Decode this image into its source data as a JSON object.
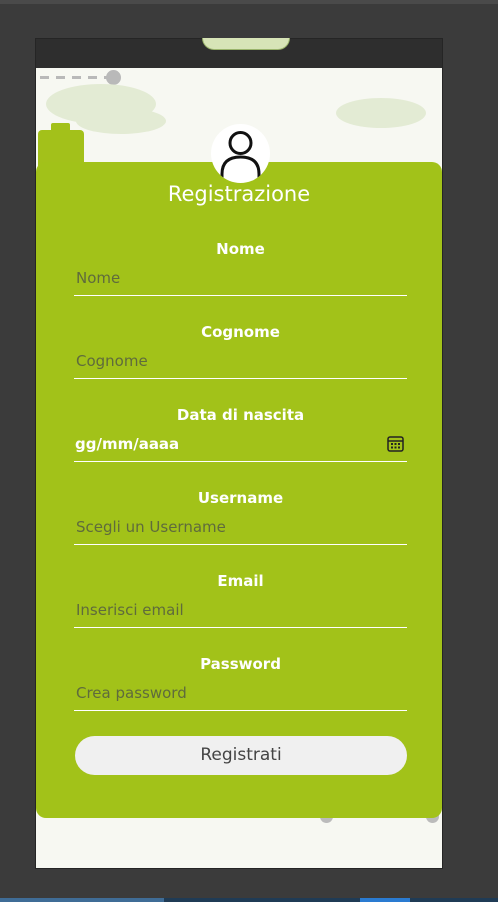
{
  "form": {
    "title": "Registrazione",
    "fields": [
      {
        "label": "Nome",
        "placeholder": "Nome"
      },
      {
        "label": "Cognome",
        "placeholder": "Cognome"
      },
      {
        "label": "Data di nascita",
        "value": "gg/mm/aaaa"
      },
      {
        "label": "Username",
        "placeholder": "Scegli un Username"
      },
      {
        "label": "Email",
        "placeholder": "Inserisci email"
      },
      {
        "label": "Password",
        "placeholder": "Crea password"
      }
    ],
    "submit_label": "Registrati"
  },
  "icons": {
    "avatar": "user-icon",
    "date": "calendar-icon"
  },
  "colors": {
    "accent": "#a2c219",
    "page_background": "#3b3b3b",
    "button_background": "#f0f0f0"
  }
}
